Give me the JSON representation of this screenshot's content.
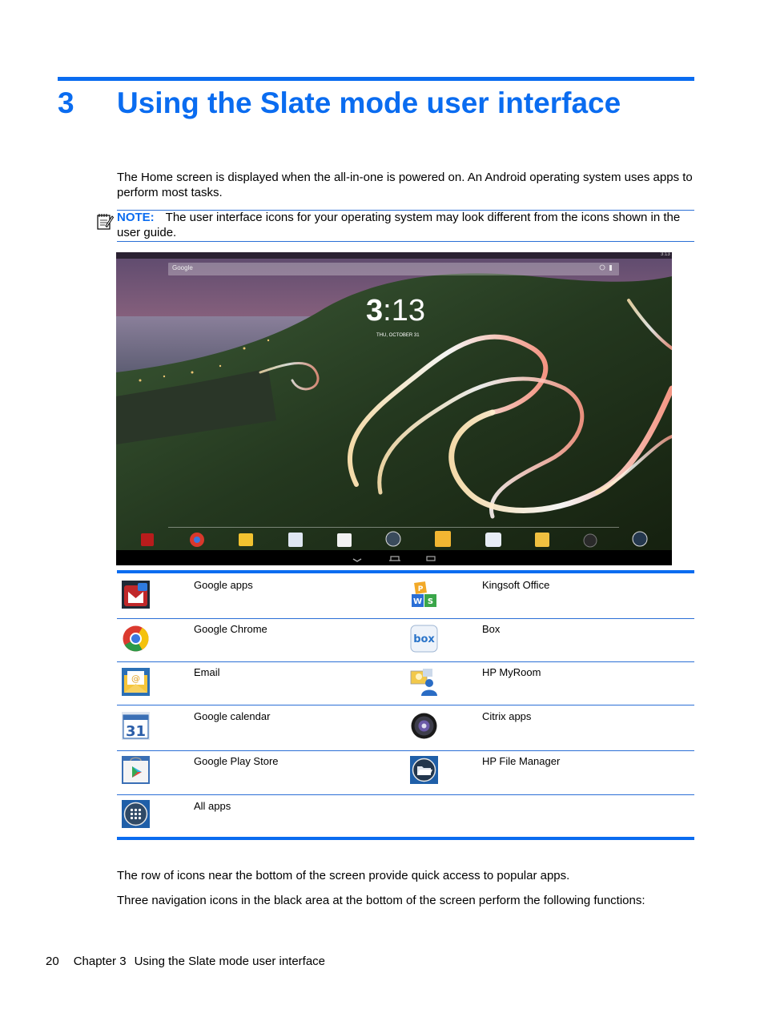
{
  "chapter": {
    "number": "3",
    "title": "Using the Slate mode user interface"
  },
  "intro": "The Home screen is displayed when the all-in-one is powered on. An Android operating system uses apps to perform most tasks.",
  "note": {
    "label": "NOTE:",
    "text": "The user interface icons for your operating system may look different from the icons shown in the user guide."
  },
  "screenshot": {
    "search_label": "Google",
    "status_time": "3:13",
    "clock_hour": "3",
    "clock_minutes": ":13",
    "date": "THU, OCTOBER 31",
    "dock_icons": [
      "google-apps-icon",
      "chrome-icon",
      "email-icon",
      "calendar-icon",
      "play-store-icon",
      "all-apps-icon",
      "kingsoft-office-icon",
      "box-icon",
      "hp-myroom-icon",
      "citrix-icon",
      "file-manager-icon"
    ],
    "nav_icons": [
      "back-icon",
      "home-icon",
      "recent-apps-icon"
    ]
  },
  "apps_table": {
    "left": [
      {
        "icon": "google-apps-icon",
        "label": "Google apps"
      },
      {
        "icon": "chrome-icon",
        "label": "Google Chrome"
      },
      {
        "icon": "email-icon",
        "label": "Email"
      },
      {
        "icon": "calendar-icon",
        "label": "Google calendar",
        "calendar_day": "31"
      },
      {
        "icon": "play-store-icon",
        "label": "Google Play Store"
      },
      {
        "icon": "all-apps-icon",
        "label": "All apps"
      }
    ],
    "right": [
      {
        "icon": "kingsoft-office-icon",
        "label": "Kingsoft Office"
      },
      {
        "icon": "box-icon",
        "label": "Box",
        "logo_text": "box"
      },
      {
        "icon": "hp-myroom-icon",
        "label": "HP MyRoom"
      },
      {
        "icon": "citrix-icon",
        "label": "Citrix apps"
      },
      {
        "icon": "file-manager-icon",
        "label": "HP File Manager"
      }
    ]
  },
  "paragraphs": [
    "The row of icons near the bottom of the screen provide quick access to popular apps.",
    "Three navigation icons in the black area at the bottom of the screen perform the following functions:"
  ],
  "footer": {
    "page": "20",
    "chapter": "Chapter 3",
    "title": "Using the Slate mode user interface"
  },
  "colors": {
    "accent": "#0a6cf0",
    "rule": "#2b6fd6"
  }
}
